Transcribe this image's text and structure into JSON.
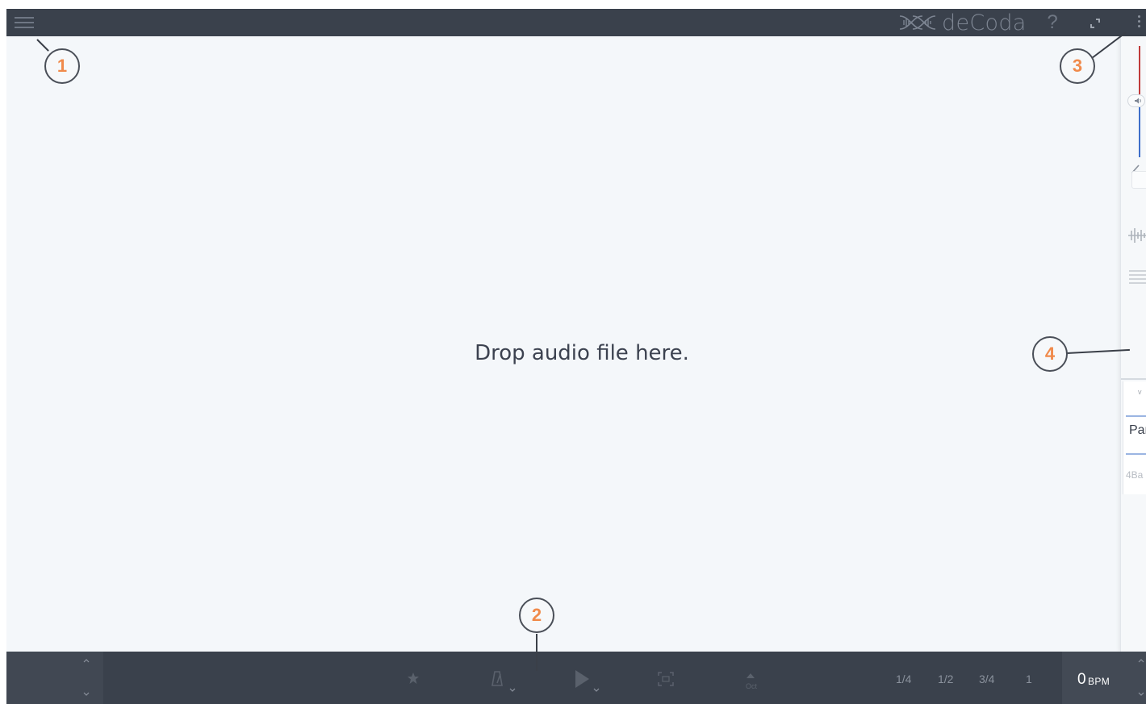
{
  "app": {
    "brand_name": "deCoda"
  },
  "topbar": {
    "help_label": "?"
  },
  "main": {
    "drop_prompt": "Drop audio file here."
  },
  "sidepanel": {
    "card": {
      "chevron": "v",
      "section_label": "Par",
      "bars_label": "4Ba"
    }
  },
  "bottombar": {
    "octave_label": "Oct",
    "speed_options": [
      "1/4",
      "1/2",
      "3/4",
      "1"
    ],
    "bpm_value": "0",
    "bpm_unit": "BPM"
  },
  "callouts": [
    "1",
    "2",
    "3",
    "4"
  ],
  "colors": {
    "topbar_bg": "#3a414c",
    "canvas_bg": "#f4f7fa",
    "callout_number": "#f08a4b",
    "volume_red": "#c03a3a",
    "volume_blue": "#3e6ec9"
  },
  "icons": {
    "menu": "hamburger-icon",
    "logo": "dna-waveform-logo-icon",
    "help": "question-mark-icon",
    "fullscreen": "fullscreen-icon",
    "more": "kebab-menu-icon",
    "volume": "speaker-icon",
    "collapse": "chevron-left-icon",
    "waveform": "waveform-icon",
    "list": "list-icon",
    "star": "star-icon",
    "metronome": "metronome-icon",
    "play": "play-icon",
    "loop": "loop-region-icon"
  }
}
